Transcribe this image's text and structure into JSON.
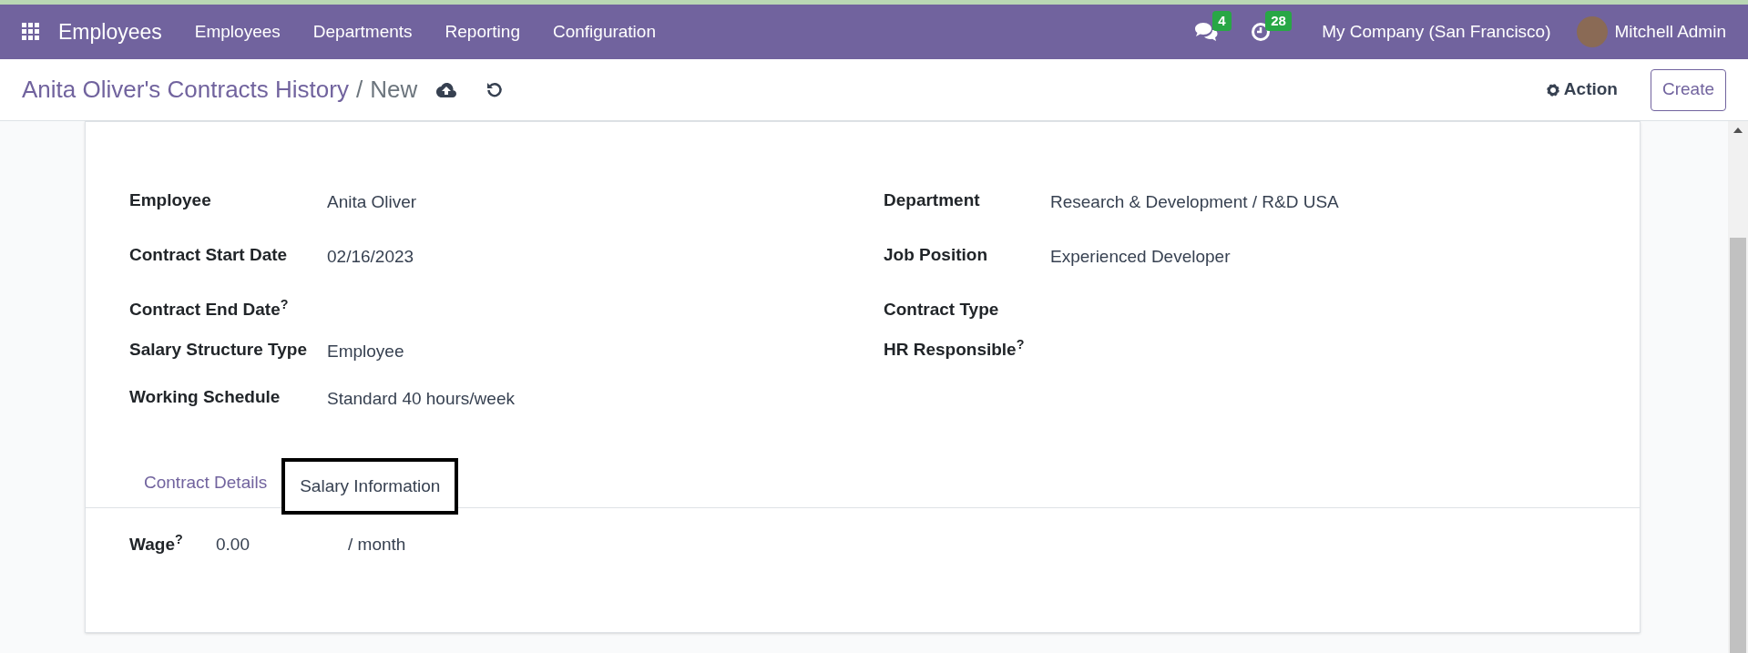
{
  "navbar": {
    "app_name": "Employees",
    "menu": [
      "Employees",
      "Departments",
      "Reporting",
      "Configuration"
    ],
    "messages_count": "4",
    "activities_count": "28",
    "company": "My Company (San Francisco)",
    "user": "Mitchell Admin"
  },
  "control_panel": {
    "breadcrumb": "Anita Oliver's Contracts History",
    "separator": "/",
    "current": "New",
    "action_label": "Action",
    "create_label": "Create"
  },
  "fields_left": [
    {
      "label": "Employee",
      "value": "Anita Oliver"
    },
    {
      "label": "Contract Start Date",
      "value": "02/16/2023"
    },
    {
      "label": "Contract End Date$^{?}$"
    },
    {
      "label": "Salary Structure Type",
      "value": "Employee"
    },
    {
      "label": "Working Schedule",
      "value": "Standard 40 hours/week"
    }
  ],
  "fields_right": [
    {
      "label": "Department",
      "value": "Research & Development / R&D USA"
    },
    {
      "label": "Job Position",
      "value": "Experienced Developer"
    },
    {
      "label": "Contract Type"
    },
    {
      "label": "HR Responsible$^{?}$"
    }
  ],
  "tabs": [
    {
      "label": "Contract Details",
      "selected": false
    },
    {
      "label": "Salary Information",
      "selected": true
    }
  ],
  "wage": {
    "label": "Wage$^{?}$",
    "value": "0.00",
    "unit": "/ month"
  }
}
